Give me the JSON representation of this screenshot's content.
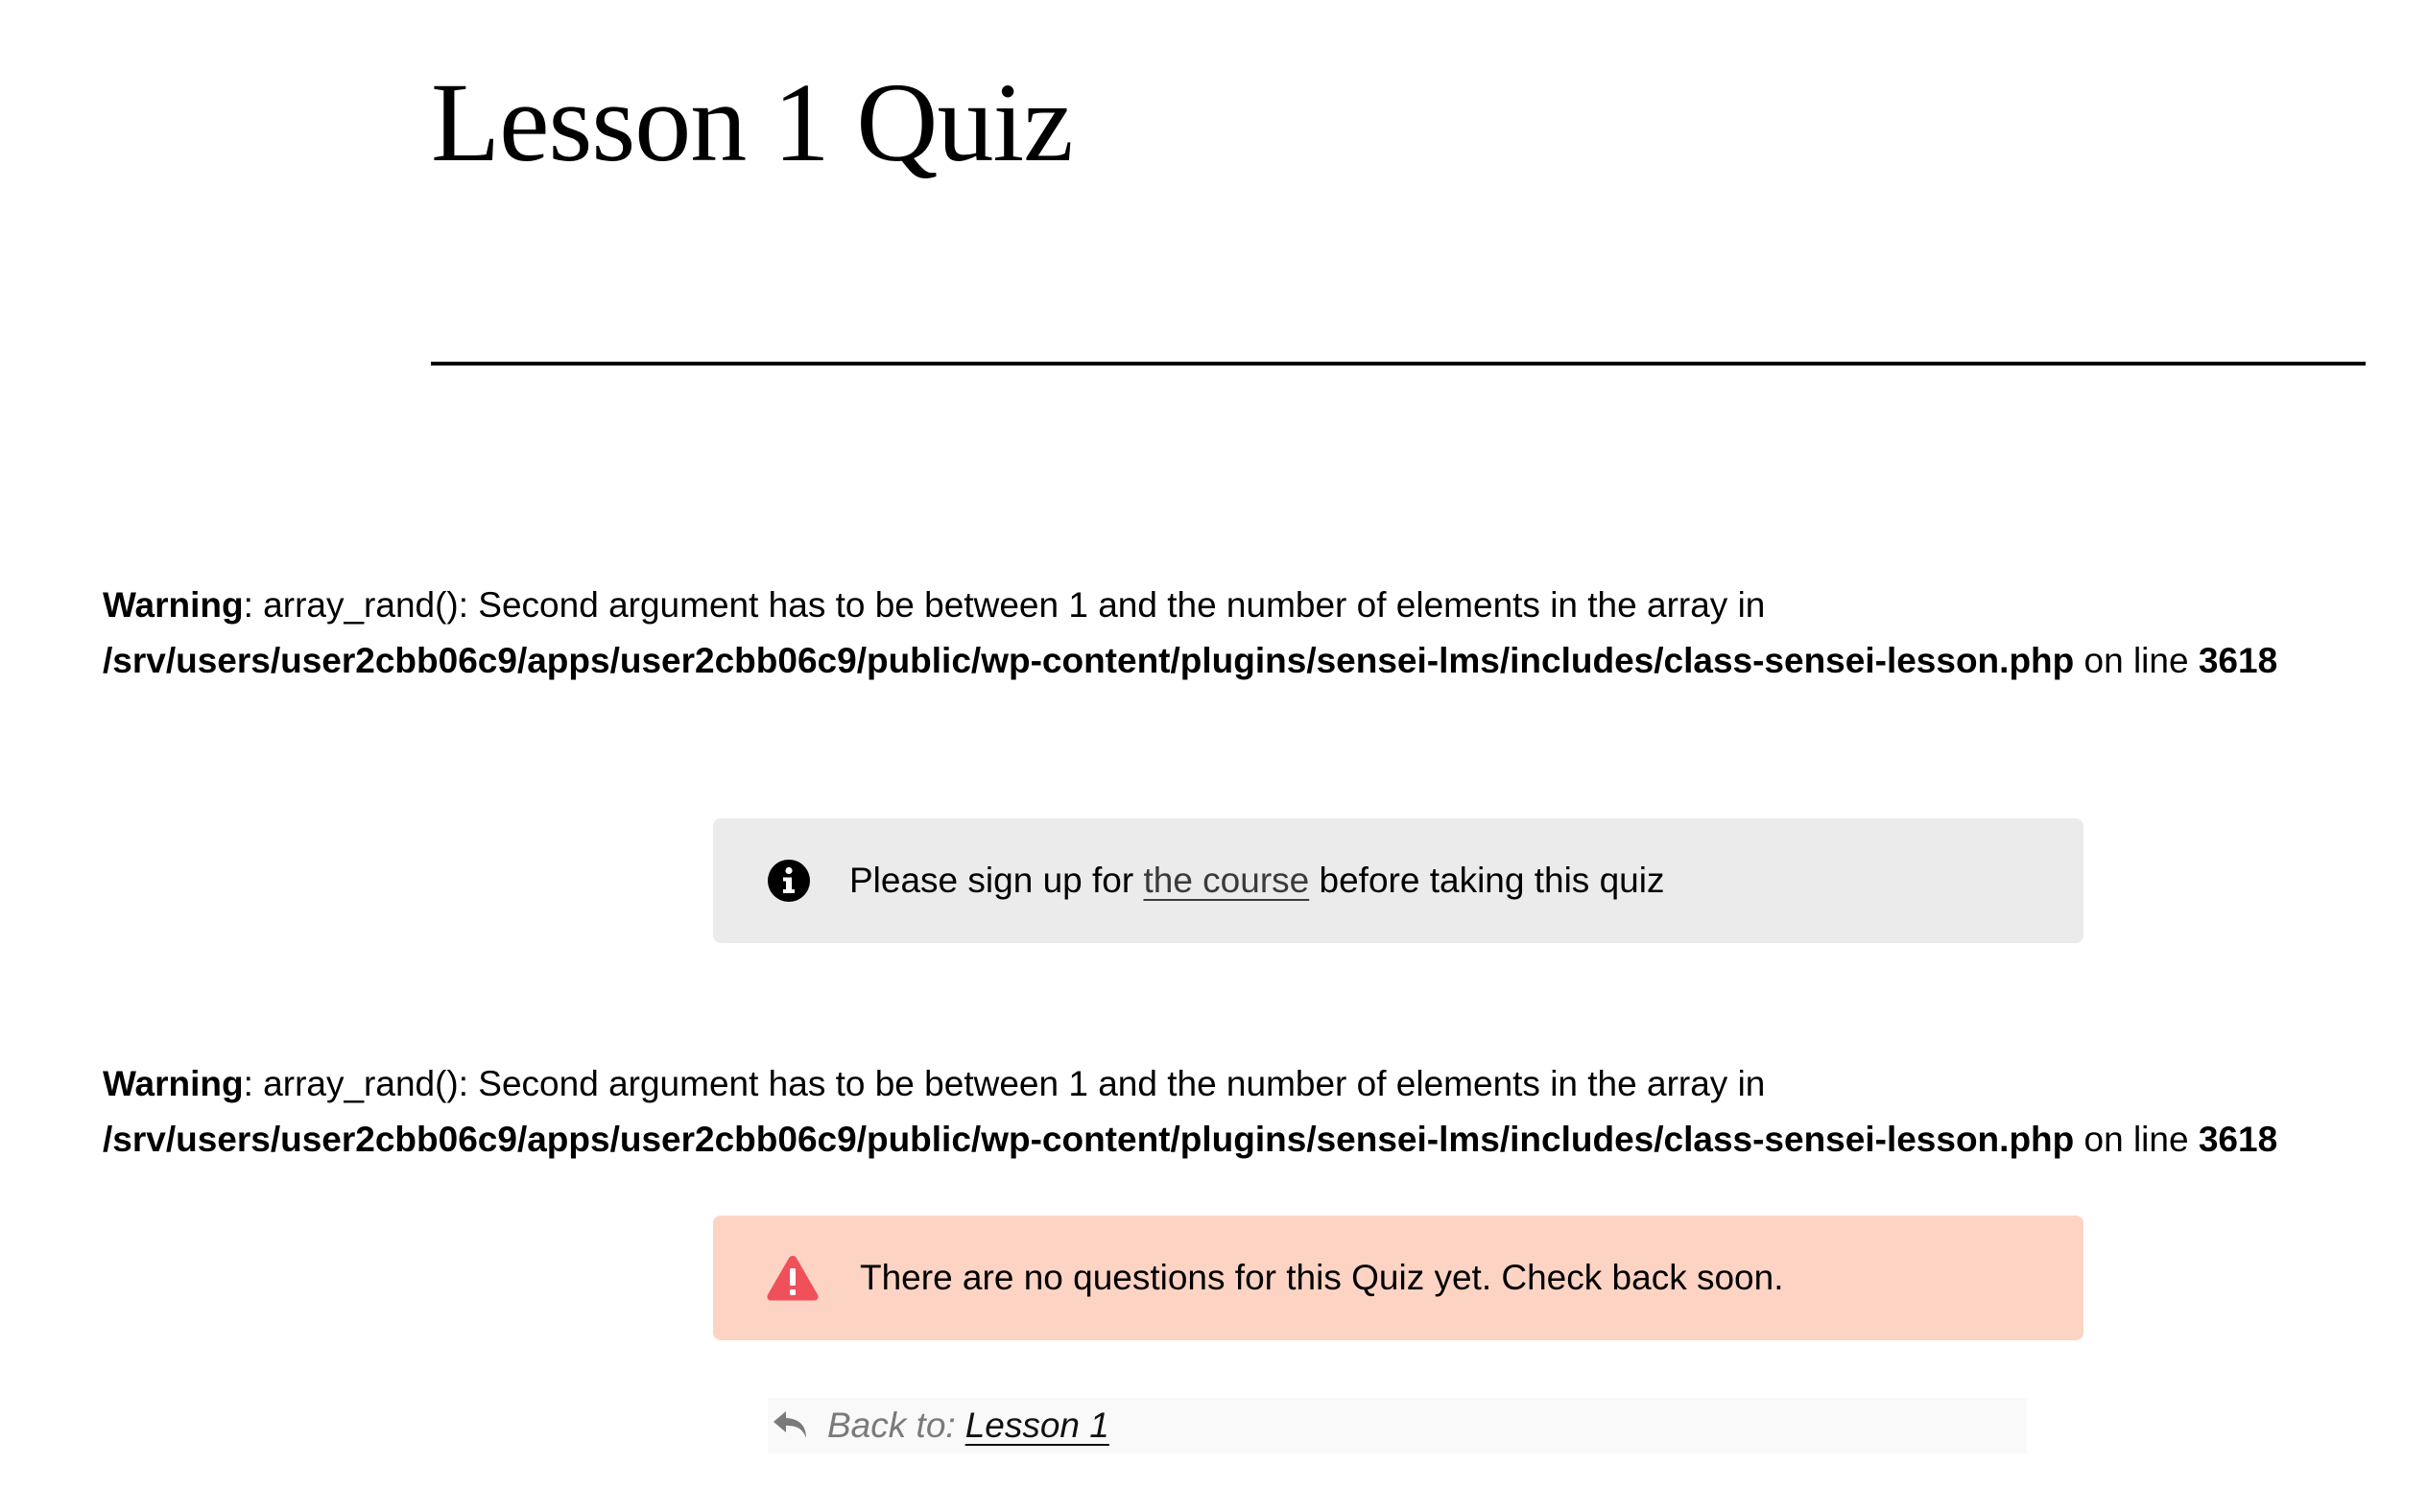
{
  "page": {
    "title": "Lesson 1 Quiz"
  },
  "warnings": [
    {
      "label": "Warning",
      "message": ": array_rand(): Second argument has to be between 1 and the number of elements in the array in",
      "file": "/srv/users/user2cbb06c9/apps/user2cbb06c9/public/wp-content/plugins/sensei-lms/includes/class-sensei-lesson.php",
      "on_line_text": " on line ",
      "line": "3618"
    },
    {
      "label": "Warning",
      "message": ": array_rand(): Second argument has to be between 1 and the number of elements in the array in",
      "file": "/srv/users/user2cbb06c9/apps/user2cbb06c9/public/wp-content/plugins/sensei-lms/includes/class-sensei-lesson.php",
      "on_line_text": " on line ",
      "line": "3618"
    }
  ],
  "signup_notice": {
    "icon": "info-icon",
    "text_before": "Please sign up for ",
    "link_text": "the course",
    "text_after": " before taking this quiz",
    "background": "#ebebeb"
  },
  "no_questions_notice": {
    "icon": "warning-triangle-icon",
    "text": "There are no questions for this Quiz yet. Check back soon.",
    "background": "#fdd4c3",
    "icon_color": "#f0505a"
  },
  "back_nav": {
    "icon": "reply-arrow-icon",
    "label": "Back to:",
    "link_text": "Lesson 1"
  }
}
